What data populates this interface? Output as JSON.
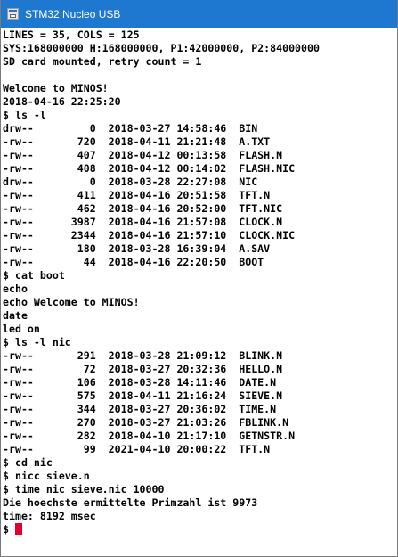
{
  "window": {
    "title": "STM32 Nucleo USB"
  },
  "terminal": {
    "lines": [
      "LINES = 35, COLS = 125",
      "SYS:168000000 H:168000000, P1:42000000, P2:84000000",
      "SD card mounted, retry count = 1",
      "",
      "Welcome to MINOS!",
      "2018-04-16 22:25:20",
      "$ ls -l",
      "drw--         0  2018-03-27 14:58:46  BIN",
      "-rw--       720  2018-04-11 21:21:48  A.TXT",
      "-rw--       407  2018-04-12 00:13:58  FLASH.N",
      "-rw--       408  2018-04-12 00:14:02  FLASH.NIC",
      "drw--         0  2018-03-28 22:27:08  NIC",
      "-rw--       411  2018-04-16 20:51:58  TFT.N",
      "-rw--       462  2018-04-16 20:52:00  TFT.NIC",
      "-rw--      3987  2018-04-16 21:57:08  CLOCK.N",
      "-rw--      2344  2018-04-16 21:57:10  CLOCK.NIC",
      "-rw--       180  2018-03-28 16:39:04  A.SAV",
      "-rw--        44  2018-04-16 22:20:50  BOOT",
      "$ cat boot",
      "echo",
      "echo Welcome to MINOS!",
      "date",
      "led on",
      "$ ls -l nic",
      "-rw--       291  2018-03-28 21:09:12  BLINK.N",
      "-rw--        72  2018-03-27 20:32:36  HELLO.N",
      "-rw--       106  2018-03-28 14:11:46  DATE.N",
      "-rw--       575  2018-04-11 21:16:24  SIEVE.N",
      "-rw--       344  2018-03-27 20:36:02  TIME.N",
      "-rw--       270  2018-03-27 21:03:26  FBLINK.N",
      "-rw--       282  2018-04-10 21:17:10  GETNSTR.N",
      "-rw--        99  2021-04-10 20:00:22  TFT.N",
      "$ cd nic",
      "$ nicc sieve.n",
      "$ time nic sieve.nic 10000",
      "Die hoechste ermittelte Primzahl ist 9973",
      "time: 8192 msec"
    ],
    "prompt": "$ ",
    "cursor_color": "#e4002b"
  },
  "colors": {
    "titlebar": "#1f78d0",
    "title_text": "#ffffff",
    "background": "#ffffff",
    "text": "#000000"
  }
}
